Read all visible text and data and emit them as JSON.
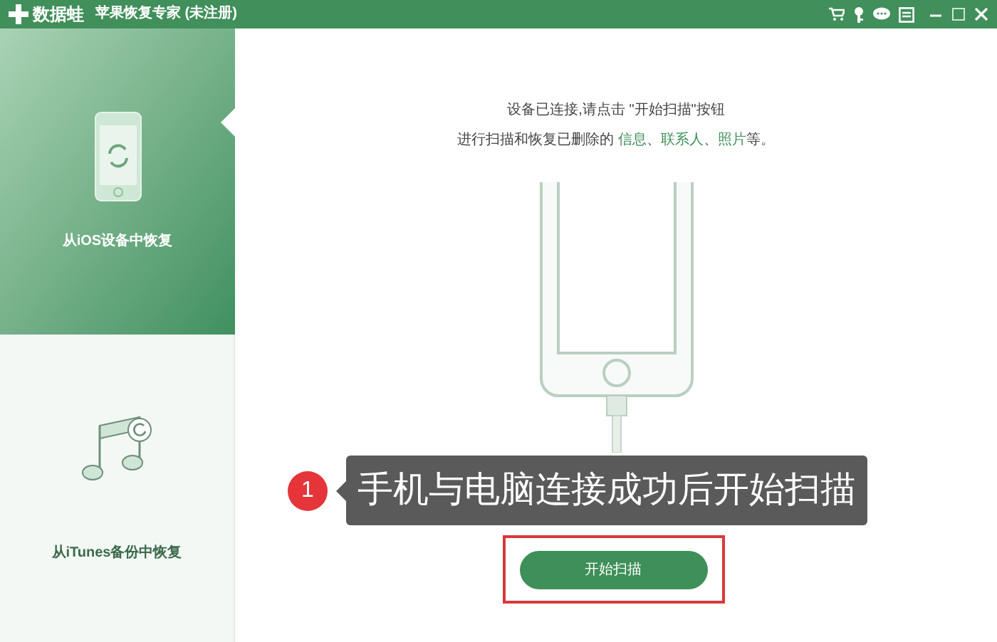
{
  "window": {
    "logo": "数据蛙",
    "title": "苹果恢复专家 (未注册)"
  },
  "sidebar": {
    "items": [
      {
        "label": "从iOS设备中恢复",
        "kind": "device",
        "selected": true
      },
      {
        "label": "从iTunes备份中恢复",
        "kind": "itunes",
        "selected": false
      }
    ]
  },
  "main": {
    "line1": "设备已连接,请点击 \"开始扫描\"按钮",
    "line2": [
      {
        "text": "进行扫描和恢复已删除的 ",
        "kind": "plain"
      },
      {
        "text": "信息",
        "kind": "link"
      },
      {
        "text": "、",
        "kind": "plain"
      },
      {
        "text": "联系人",
        "kind": "link"
      },
      {
        "text": "、",
        "kind": "plain"
      },
      {
        "text": "照片",
        "kind": "link"
      },
      {
        "text": "等。",
        "kind": "plain"
      }
    ],
    "scan_button": "开始扫描"
  },
  "callout": {
    "number": "1",
    "text": "手机与电脑连接成功后开始扫描"
  }
}
